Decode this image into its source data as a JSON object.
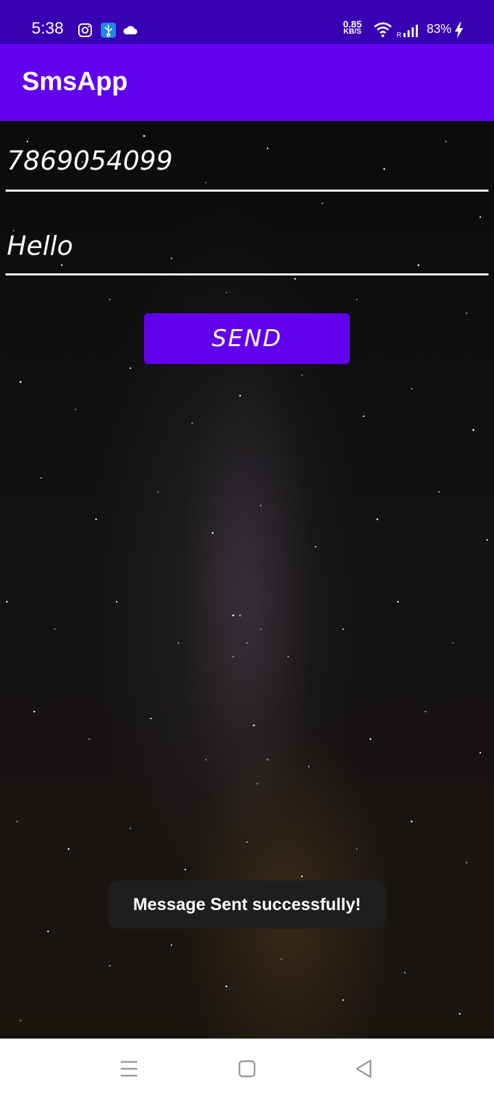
{
  "status_bar": {
    "time": "5:38",
    "net_speed_value": "0.85",
    "net_speed_unit": "KB/S",
    "battery": "83%",
    "icons": [
      "instagram-icon",
      "usb-icon",
      "cloud-icon",
      "wifi-icon",
      "signal-icon",
      "charging-icon"
    ],
    "background_color": "#3700b3"
  },
  "app_bar": {
    "title": "SmsApp",
    "background_color": "#6200ee"
  },
  "form": {
    "phone_value": "7869054099",
    "message_value": "Hello",
    "send_label": "SEND",
    "send_button_color": "#6200ee"
  },
  "toast": {
    "text": "Message Sent successfully!"
  },
  "nav_bar": {
    "icons": [
      "menu-icon",
      "home-square-icon",
      "back-triangle-icon"
    ]
  }
}
